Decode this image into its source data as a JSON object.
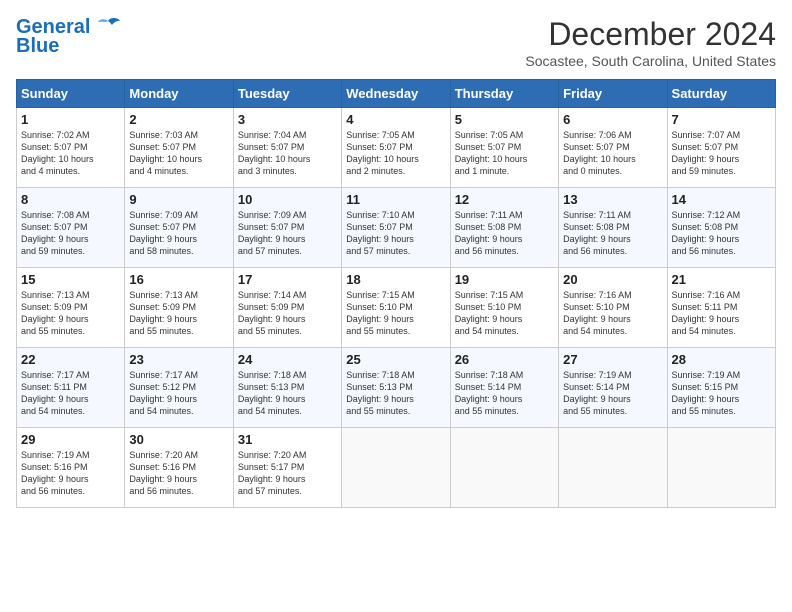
{
  "header": {
    "logo_line1": "General",
    "logo_line2": "Blue",
    "month": "December 2024",
    "location": "Socastee, South Carolina, United States"
  },
  "days_of_week": [
    "Sunday",
    "Monday",
    "Tuesday",
    "Wednesday",
    "Thursday",
    "Friday",
    "Saturday"
  ],
  "weeks": [
    [
      {
        "day": "1",
        "data": "Sunrise: 7:02 AM\nSunset: 5:07 PM\nDaylight: 10 hours\nand 4 minutes."
      },
      {
        "day": "2",
        "data": "Sunrise: 7:03 AM\nSunset: 5:07 PM\nDaylight: 10 hours\nand 4 minutes."
      },
      {
        "day": "3",
        "data": "Sunrise: 7:04 AM\nSunset: 5:07 PM\nDaylight: 10 hours\nand 3 minutes."
      },
      {
        "day": "4",
        "data": "Sunrise: 7:05 AM\nSunset: 5:07 PM\nDaylight: 10 hours\nand 2 minutes."
      },
      {
        "day": "5",
        "data": "Sunrise: 7:05 AM\nSunset: 5:07 PM\nDaylight: 10 hours\nand 1 minute."
      },
      {
        "day": "6",
        "data": "Sunrise: 7:06 AM\nSunset: 5:07 PM\nDaylight: 10 hours\nand 0 minutes."
      },
      {
        "day": "7",
        "data": "Sunrise: 7:07 AM\nSunset: 5:07 PM\nDaylight: 9 hours\nand 59 minutes."
      }
    ],
    [
      {
        "day": "8",
        "data": "Sunrise: 7:08 AM\nSunset: 5:07 PM\nDaylight: 9 hours\nand 59 minutes."
      },
      {
        "day": "9",
        "data": "Sunrise: 7:09 AM\nSunset: 5:07 PM\nDaylight: 9 hours\nand 58 minutes."
      },
      {
        "day": "10",
        "data": "Sunrise: 7:09 AM\nSunset: 5:07 PM\nDaylight: 9 hours\nand 57 minutes."
      },
      {
        "day": "11",
        "data": "Sunrise: 7:10 AM\nSunset: 5:07 PM\nDaylight: 9 hours\nand 57 minutes."
      },
      {
        "day": "12",
        "data": "Sunrise: 7:11 AM\nSunset: 5:08 PM\nDaylight: 9 hours\nand 56 minutes."
      },
      {
        "day": "13",
        "data": "Sunrise: 7:11 AM\nSunset: 5:08 PM\nDaylight: 9 hours\nand 56 minutes."
      },
      {
        "day": "14",
        "data": "Sunrise: 7:12 AM\nSunset: 5:08 PM\nDaylight: 9 hours\nand 56 minutes."
      }
    ],
    [
      {
        "day": "15",
        "data": "Sunrise: 7:13 AM\nSunset: 5:09 PM\nDaylight: 9 hours\nand 55 minutes."
      },
      {
        "day": "16",
        "data": "Sunrise: 7:13 AM\nSunset: 5:09 PM\nDaylight: 9 hours\nand 55 minutes."
      },
      {
        "day": "17",
        "data": "Sunrise: 7:14 AM\nSunset: 5:09 PM\nDaylight: 9 hours\nand 55 minutes."
      },
      {
        "day": "18",
        "data": "Sunrise: 7:15 AM\nSunset: 5:10 PM\nDaylight: 9 hours\nand 55 minutes."
      },
      {
        "day": "19",
        "data": "Sunrise: 7:15 AM\nSunset: 5:10 PM\nDaylight: 9 hours\nand 54 minutes."
      },
      {
        "day": "20",
        "data": "Sunrise: 7:16 AM\nSunset: 5:10 PM\nDaylight: 9 hours\nand 54 minutes."
      },
      {
        "day": "21",
        "data": "Sunrise: 7:16 AM\nSunset: 5:11 PM\nDaylight: 9 hours\nand 54 minutes."
      }
    ],
    [
      {
        "day": "22",
        "data": "Sunrise: 7:17 AM\nSunset: 5:11 PM\nDaylight: 9 hours\nand 54 minutes."
      },
      {
        "day": "23",
        "data": "Sunrise: 7:17 AM\nSunset: 5:12 PM\nDaylight: 9 hours\nand 54 minutes."
      },
      {
        "day": "24",
        "data": "Sunrise: 7:18 AM\nSunset: 5:13 PM\nDaylight: 9 hours\nand 54 minutes."
      },
      {
        "day": "25",
        "data": "Sunrise: 7:18 AM\nSunset: 5:13 PM\nDaylight: 9 hours\nand 55 minutes."
      },
      {
        "day": "26",
        "data": "Sunrise: 7:18 AM\nSunset: 5:14 PM\nDaylight: 9 hours\nand 55 minutes."
      },
      {
        "day": "27",
        "data": "Sunrise: 7:19 AM\nSunset: 5:14 PM\nDaylight: 9 hours\nand 55 minutes."
      },
      {
        "day": "28",
        "data": "Sunrise: 7:19 AM\nSunset: 5:15 PM\nDaylight: 9 hours\nand 55 minutes."
      }
    ],
    [
      {
        "day": "29",
        "data": "Sunrise: 7:19 AM\nSunset: 5:16 PM\nDaylight: 9 hours\nand 56 minutes."
      },
      {
        "day": "30",
        "data": "Sunrise: 7:20 AM\nSunset: 5:16 PM\nDaylight: 9 hours\nand 56 minutes."
      },
      {
        "day": "31",
        "data": "Sunrise: 7:20 AM\nSunset: 5:17 PM\nDaylight: 9 hours\nand 57 minutes."
      },
      {
        "day": "",
        "data": ""
      },
      {
        "day": "",
        "data": ""
      },
      {
        "day": "",
        "data": ""
      },
      {
        "day": "",
        "data": ""
      }
    ]
  ]
}
